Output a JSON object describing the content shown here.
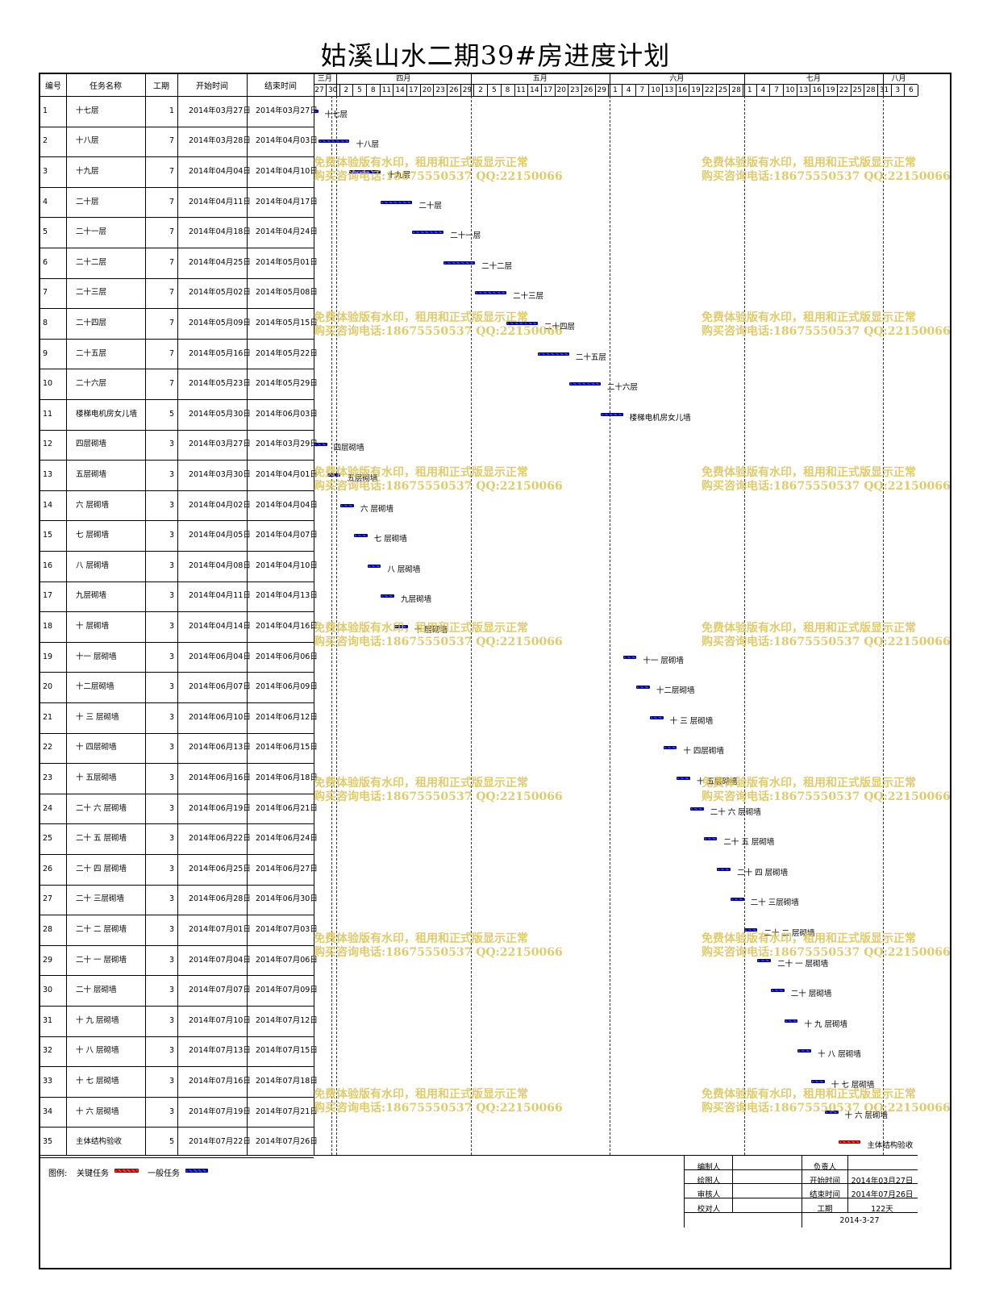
{
  "title": "姑溪山水二期39#房进度计划",
  "columns": [
    "编号",
    "任务名称",
    "工期",
    "开始时间",
    "结束时间"
  ],
  "months": [
    "三月",
    "四月",
    "五月",
    "六月",
    "七月",
    "八月"
  ],
  "days": [
    "27",
    "30",
    "2",
    "5",
    "8",
    "11",
    "14",
    "17",
    "20",
    "23",
    "26",
    "29",
    "2",
    "5",
    "8",
    "11",
    "14",
    "17",
    "20",
    "23",
    "26",
    "29",
    "1",
    "4",
    "7",
    "10",
    "13",
    "16",
    "19",
    "22",
    "25",
    "28",
    "1",
    "4",
    "7",
    "10",
    "13",
    "16",
    "19",
    "22",
    "25",
    "28",
    "31",
    "3",
    "6"
  ],
  "chart_data": {
    "type": "gantt",
    "x_range": [
      "2014-03-27",
      "2014-08-08"
    ],
    "tasks": [
      {
        "id": "1",
        "name": "十七层",
        "duration": "1",
        "start": "2014年03月27日",
        "end": "2014年03月27日",
        "s": "2014-03-27",
        "e": "2014-03-27",
        "critical": false,
        "label": "十七层"
      },
      {
        "id": "2",
        "name": "十八层",
        "duration": "7",
        "start": "2014年03月28日",
        "end": "2014年04月03日",
        "s": "2014-03-28",
        "e": "2014-04-03",
        "critical": false,
        "label": "十八层"
      },
      {
        "id": "3",
        "name": "十九层",
        "duration": "7",
        "start": "2014年04月04日",
        "end": "2014年04月10日",
        "s": "2014-04-04",
        "e": "2014-04-10",
        "critical": false,
        "label": "十九层"
      },
      {
        "id": "4",
        "name": "二十层",
        "duration": "7",
        "start": "2014年04月11日",
        "end": "2014年04月17日",
        "s": "2014-04-11",
        "e": "2014-04-17",
        "critical": false,
        "label": "二十层"
      },
      {
        "id": "5",
        "name": "二十一层",
        "duration": "7",
        "start": "2014年04月18日",
        "end": "2014年04月24日",
        "s": "2014-04-18",
        "e": "2014-04-24",
        "critical": false,
        "label": "二十一层"
      },
      {
        "id": "6",
        "name": "二十二层",
        "duration": "7",
        "start": "2014年04月25日",
        "end": "2014年05月01日",
        "s": "2014-04-25",
        "e": "2014-05-01",
        "critical": false,
        "label": "二十二层"
      },
      {
        "id": "7",
        "name": "二十三层",
        "duration": "7",
        "start": "2014年05月02日",
        "end": "2014年05月08日",
        "s": "2014-05-02",
        "e": "2014-05-08",
        "critical": false,
        "label": "二十三层"
      },
      {
        "id": "8",
        "name": "二十四层",
        "duration": "7",
        "start": "2014年05月09日",
        "end": "2014年05月15日",
        "s": "2014-05-09",
        "e": "2014-05-15",
        "critical": false,
        "label": "二十四层"
      },
      {
        "id": "9",
        "name": "二十五层",
        "duration": "7",
        "start": "2014年05月16日",
        "end": "2014年05月22日",
        "s": "2014-05-16",
        "e": "2014-05-22",
        "critical": false,
        "label": "二十五层"
      },
      {
        "id": "10",
        "name": "二十六层",
        "duration": "7",
        "start": "2014年05月23日",
        "end": "2014年05月29日",
        "s": "2014-05-23",
        "e": "2014-05-29",
        "critical": false,
        "label": "二十六层"
      },
      {
        "id": "11",
        "name": "楼梯电机房女儿墙",
        "duration": "5",
        "start": "2014年05月30日",
        "end": "2014年06月03日",
        "s": "2014-05-30",
        "e": "2014-06-03",
        "critical": false,
        "label": "楼梯电机房女儿墙"
      },
      {
        "id": "12",
        "name": "四层砌墙",
        "duration": "3",
        "start": "2014年03月27日",
        "end": "2014年03月29日",
        "s": "2014-03-27",
        "e": "2014-03-29",
        "critical": false,
        "label": "四层砌墙"
      },
      {
        "id": "13",
        "name": "五层砌墙",
        "duration": "3",
        "start": "2014年03月30日",
        "end": "2014年04月01日",
        "s": "2014-03-30",
        "e": "2014-04-01",
        "critical": false,
        "label": "五层砌墙"
      },
      {
        "id": "14",
        "name": "六 层砌墙",
        "duration": "3",
        "start": "2014年04月02日",
        "end": "2014年04月04日",
        "s": "2014-04-02",
        "e": "2014-04-04",
        "critical": false,
        "label": "六 层砌墙"
      },
      {
        "id": "15",
        "name": "七 层砌墙",
        "duration": "3",
        "start": "2014年04月05日",
        "end": "2014年04月07日",
        "s": "2014-04-05",
        "e": "2014-04-07",
        "critical": false,
        "label": "七 层砌墙"
      },
      {
        "id": "16",
        "name": "八 层砌墙",
        "duration": "3",
        "start": "2014年04月08日",
        "end": "2014年04月10日",
        "s": "2014-04-08",
        "e": "2014-04-10",
        "critical": false,
        "label": "八 层砌墙"
      },
      {
        "id": "17",
        "name": "九层砌墙",
        "duration": "3",
        "start": "2014年04月11日",
        "end": "2014年04月13日",
        "s": "2014-04-11",
        "e": "2014-04-13",
        "critical": false,
        "label": "九层砌墙"
      },
      {
        "id": "18",
        "name": "十 层砌墙",
        "duration": "3",
        "start": "2014年04月14日",
        "end": "2014年04月16日",
        "s": "2014-04-14",
        "e": "2014-04-16",
        "critical": false,
        "label": "十 层砌墙"
      },
      {
        "id": "19",
        "name": "十一 层砌墙",
        "duration": "3",
        "start": "2014年06月04日",
        "end": "2014年06月06日",
        "s": "2014-06-04",
        "e": "2014-06-06",
        "critical": false,
        "label": "十一 层砌墙"
      },
      {
        "id": "20",
        "name": "十二层砌墙",
        "duration": "3",
        "start": "2014年06月07日",
        "end": "2014年06月09日",
        "s": "2014-06-07",
        "e": "2014-06-09",
        "critical": false,
        "label": "十二层砌墙"
      },
      {
        "id": "21",
        "name": "十 三 层砌墙",
        "duration": "3",
        "start": "2014年06月10日",
        "end": "2014年06月12日",
        "s": "2014-06-10",
        "e": "2014-06-12",
        "critical": false,
        "label": "十 三 层砌墙"
      },
      {
        "id": "22",
        "name": "十 四层砌墙",
        "duration": "3",
        "start": "2014年06月13日",
        "end": "2014年06月15日",
        "s": "2014-06-13",
        "e": "2014-06-15",
        "critical": false,
        "label": "十 四层砌墙"
      },
      {
        "id": "23",
        "name": "十 五层砌墙",
        "duration": "3",
        "start": "2014年06月16日",
        "end": "2014年06月18日",
        "s": "2014-06-16",
        "e": "2014-06-18",
        "critical": false,
        "label": "十 五层砌墙"
      },
      {
        "id": "24",
        "name": "二十 六 层砌墙",
        "duration": "3",
        "start": "2014年06月19日",
        "end": "2014年06月21日",
        "s": "2014-06-19",
        "e": "2014-06-21",
        "critical": false,
        "label": "二十 六 层砌墙"
      },
      {
        "id": "25",
        "name": "二十 五 层砌墙",
        "duration": "3",
        "start": "2014年06月22日",
        "end": "2014年06月24日",
        "s": "2014-06-22",
        "e": "2014-06-24",
        "critical": false,
        "label": "二十 五 层砌墙"
      },
      {
        "id": "26",
        "name": "二十 四 层砌墙",
        "duration": "3",
        "start": "2014年06月25日",
        "end": "2014年06月27日",
        "s": "2014-06-25",
        "e": "2014-06-27",
        "critical": false,
        "label": "二十 四 层砌墙"
      },
      {
        "id": "27",
        "name": "二十 三层砌墙",
        "duration": "3",
        "start": "2014年06月28日",
        "end": "2014年06月30日",
        "s": "2014-06-28",
        "e": "2014-06-30",
        "critical": false,
        "label": "二十 三层砌墙"
      },
      {
        "id": "28",
        "name": "二十 二 层砌墙",
        "duration": "3",
        "start": "2014年07月01日",
        "end": "2014年07月03日",
        "s": "2014-07-01",
        "e": "2014-07-03",
        "critical": false,
        "label": "二十 二 层砌墙"
      },
      {
        "id": "29",
        "name": "二十 一 层砌墙",
        "duration": "3",
        "start": "2014年07月04日",
        "end": "2014年07月06日",
        "s": "2014-07-04",
        "e": "2014-07-06",
        "critical": false,
        "label": "二十 一 层砌墙"
      },
      {
        "id": "30",
        "name": "二十 层砌墙",
        "duration": "3",
        "start": "2014年07月07日",
        "end": "2014年07月09日",
        "s": "2014-07-07",
        "e": "2014-07-09",
        "critical": false,
        "label": "二十 层砌墙"
      },
      {
        "id": "31",
        "name": "十 九 层砌墙",
        "duration": "3",
        "start": "2014年07月10日",
        "end": "2014年07月12日",
        "s": "2014-07-10",
        "e": "2014-07-12",
        "critical": false,
        "label": "十 九 层砌墙"
      },
      {
        "id": "32",
        "name": "十 八 层砌墙",
        "duration": "3",
        "start": "2014年07月13日",
        "end": "2014年07月15日",
        "s": "2014-07-13",
        "e": "2014-07-15",
        "critical": false,
        "label": "十 八 层砌墙"
      },
      {
        "id": "33",
        "name": "十 七 层砌墙",
        "duration": "3",
        "start": "2014年07月16日",
        "end": "2014年07月18日",
        "s": "2014-07-16",
        "e": "2014-07-18",
        "critical": false,
        "label": "十 七 层砌墙"
      },
      {
        "id": "34",
        "name": "十 六 层砌墙",
        "duration": "3",
        "start": "2014年07月19日",
        "end": "2014年07月21日",
        "s": "2014-07-19",
        "e": "2014-07-21",
        "critical": false,
        "label": "十 六 层砌墙"
      },
      {
        "id": "35",
        "name": "主体结构验收",
        "duration": "5",
        "start": "2014年07月22日",
        "end": "2014年07月26日",
        "s": "2014-07-22",
        "e": "2014-07-26",
        "critical": true,
        "label": "主体结构验收"
      }
    ]
  },
  "colors": {
    "critical": "#e02020",
    "normal": "#1a1aff",
    "watermark": "#d7be46"
  },
  "legend": {
    "label": "图例:",
    "critical": "关键任务",
    "normal": "一般任务"
  },
  "info": {
    "compiler_label": "编制人",
    "drawer_label": "绘图人",
    "reviewer_label": "审核人",
    "checker_label": "校对人",
    "owner_label": "负责人",
    "start_label": "开始时间",
    "start_value": "2014年03月27日",
    "end_label": "结束时间",
    "end_value": "2014年07月26日",
    "duration_label": "工期",
    "duration_value": "122天",
    "date": "2014-3-27"
  },
  "watermark": {
    "line1": "免费体验版有水印，租用和正式版显示正常",
    "line2": "购买咨询电话:18675550537 QQ:22150066"
  }
}
